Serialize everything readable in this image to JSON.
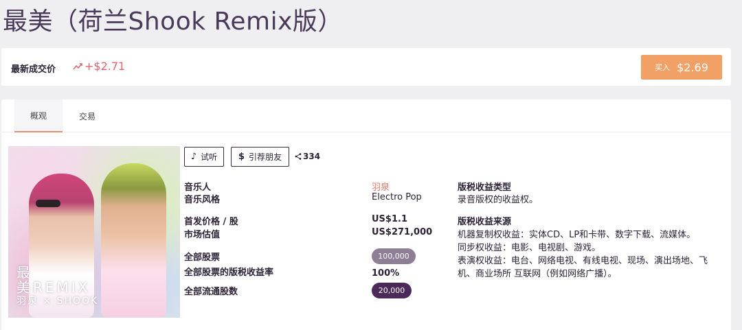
{
  "page_title": "最美（荷兰Shook Remix版）",
  "price_bar": {
    "label": "最新成交价",
    "change": "+$2.71",
    "buy_label": "买入",
    "buy_price": "$2.69"
  },
  "tabs": [
    {
      "label": "概观",
      "active": true
    },
    {
      "label": "交易",
      "active": false
    }
  ],
  "cover": {
    "line1": "最",
    "line2": "美REMIX",
    "line3": "羽泉 × SHOOK"
  },
  "actions": {
    "listen": "试听",
    "recommend": "引荐朋友",
    "share_count": "334"
  },
  "details": {
    "artist_label": "音乐人",
    "artist_value": "羽泉",
    "genre_label": "音乐风格",
    "genre_value": "Electro Pop",
    "ipo_price_label": "首发价格 / 股",
    "ipo_price_value": "US$1.1",
    "market_value_label": "市场估值",
    "market_value_value": "US$271,000",
    "total_shares_label": "全部股票",
    "total_shares_value": "100,000",
    "royalty_rate_label": "全部股票的版税收益率",
    "royalty_rate_value": "100%",
    "float_shares_label": "全部流通股数",
    "float_shares_value": "20,000"
  },
  "royalty": {
    "type_heading": "版税收益类型",
    "type_text": "录音版权的收益权。",
    "source_heading": "版税收益来源",
    "source_line1": "机器复制权收益：实体CD、LP和卡带、数字下载、流媒体。",
    "source_line2": "同步权收益：电影、电视剧、游戏。",
    "source_line3": "表演权收益：电台、网络电视、有线电视、现场、演出场地、飞",
    "source_line4": "机、商业场所 互联网（例如网络广播）。"
  },
  "colors": {
    "accent_orange": "#f2a166",
    "price_change_red": "#e0636c",
    "pill_dark": "#4b2a5a",
    "pill_muted": "#8e7f96"
  }
}
